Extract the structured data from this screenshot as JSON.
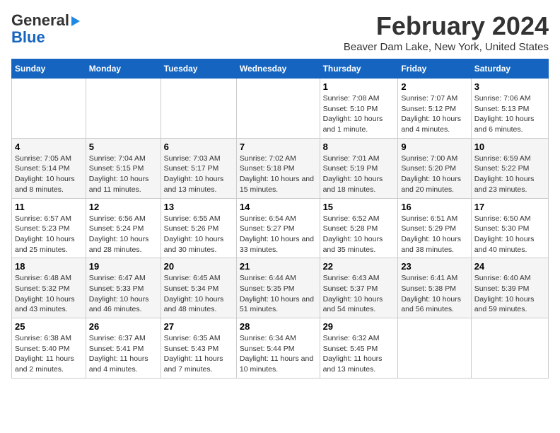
{
  "logo": {
    "line1": "General",
    "line2": "Blue"
  },
  "title": "February 2024",
  "subtitle": "Beaver Dam Lake, New York, United States",
  "days_of_week": [
    "Sunday",
    "Monday",
    "Tuesday",
    "Wednesday",
    "Thursday",
    "Friday",
    "Saturday"
  ],
  "weeks": [
    [
      {
        "day": "",
        "info": ""
      },
      {
        "day": "",
        "info": ""
      },
      {
        "day": "",
        "info": ""
      },
      {
        "day": "",
        "info": ""
      },
      {
        "day": "1",
        "info": "Sunrise: 7:08 AM\nSunset: 5:10 PM\nDaylight: 10 hours and 1 minute."
      },
      {
        "day": "2",
        "info": "Sunrise: 7:07 AM\nSunset: 5:12 PM\nDaylight: 10 hours and 4 minutes."
      },
      {
        "day": "3",
        "info": "Sunrise: 7:06 AM\nSunset: 5:13 PM\nDaylight: 10 hours and 6 minutes."
      }
    ],
    [
      {
        "day": "4",
        "info": "Sunrise: 7:05 AM\nSunset: 5:14 PM\nDaylight: 10 hours and 8 minutes."
      },
      {
        "day": "5",
        "info": "Sunrise: 7:04 AM\nSunset: 5:15 PM\nDaylight: 10 hours and 11 minutes."
      },
      {
        "day": "6",
        "info": "Sunrise: 7:03 AM\nSunset: 5:17 PM\nDaylight: 10 hours and 13 minutes."
      },
      {
        "day": "7",
        "info": "Sunrise: 7:02 AM\nSunset: 5:18 PM\nDaylight: 10 hours and 15 minutes."
      },
      {
        "day": "8",
        "info": "Sunrise: 7:01 AM\nSunset: 5:19 PM\nDaylight: 10 hours and 18 minutes."
      },
      {
        "day": "9",
        "info": "Sunrise: 7:00 AM\nSunset: 5:20 PM\nDaylight: 10 hours and 20 minutes."
      },
      {
        "day": "10",
        "info": "Sunrise: 6:59 AM\nSunset: 5:22 PM\nDaylight: 10 hours and 23 minutes."
      }
    ],
    [
      {
        "day": "11",
        "info": "Sunrise: 6:57 AM\nSunset: 5:23 PM\nDaylight: 10 hours and 25 minutes."
      },
      {
        "day": "12",
        "info": "Sunrise: 6:56 AM\nSunset: 5:24 PM\nDaylight: 10 hours and 28 minutes."
      },
      {
        "day": "13",
        "info": "Sunrise: 6:55 AM\nSunset: 5:26 PM\nDaylight: 10 hours and 30 minutes."
      },
      {
        "day": "14",
        "info": "Sunrise: 6:54 AM\nSunset: 5:27 PM\nDaylight: 10 hours and 33 minutes."
      },
      {
        "day": "15",
        "info": "Sunrise: 6:52 AM\nSunset: 5:28 PM\nDaylight: 10 hours and 35 minutes."
      },
      {
        "day": "16",
        "info": "Sunrise: 6:51 AM\nSunset: 5:29 PM\nDaylight: 10 hours and 38 minutes."
      },
      {
        "day": "17",
        "info": "Sunrise: 6:50 AM\nSunset: 5:30 PM\nDaylight: 10 hours and 40 minutes."
      }
    ],
    [
      {
        "day": "18",
        "info": "Sunrise: 6:48 AM\nSunset: 5:32 PM\nDaylight: 10 hours and 43 minutes."
      },
      {
        "day": "19",
        "info": "Sunrise: 6:47 AM\nSunset: 5:33 PM\nDaylight: 10 hours and 46 minutes."
      },
      {
        "day": "20",
        "info": "Sunrise: 6:45 AM\nSunset: 5:34 PM\nDaylight: 10 hours and 48 minutes."
      },
      {
        "day": "21",
        "info": "Sunrise: 6:44 AM\nSunset: 5:35 PM\nDaylight: 10 hours and 51 minutes."
      },
      {
        "day": "22",
        "info": "Sunrise: 6:43 AM\nSunset: 5:37 PM\nDaylight: 10 hours and 54 minutes."
      },
      {
        "day": "23",
        "info": "Sunrise: 6:41 AM\nSunset: 5:38 PM\nDaylight: 10 hours and 56 minutes."
      },
      {
        "day": "24",
        "info": "Sunrise: 6:40 AM\nSunset: 5:39 PM\nDaylight: 10 hours and 59 minutes."
      }
    ],
    [
      {
        "day": "25",
        "info": "Sunrise: 6:38 AM\nSunset: 5:40 PM\nDaylight: 11 hours and 2 minutes."
      },
      {
        "day": "26",
        "info": "Sunrise: 6:37 AM\nSunset: 5:41 PM\nDaylight: 11 hours and 4 minutes."
      },
      {
        "day": "27",
        "info": "Sunrise: 6:35 AM\nSunset: 5:43 PM\nDaylight: 11 hours and 7 minutes."
      },
      {
        "day": "28",
        "info": "Sunrise: 6:34 AM\nSunset: 5:44 PM\nDaylight: 11 hours and 10 minutes."
      },
      {
        "day": "29",
        "info": "Sunrise: 6:32 AM\nSunset: 5:45 PM\nDaylight: 11 hours and 13 minutes."
      },
      {
        "day": "",
        "info": ""
      },
      {
        "day": "",
        "info": ""
      }
    ]
  ]
}
